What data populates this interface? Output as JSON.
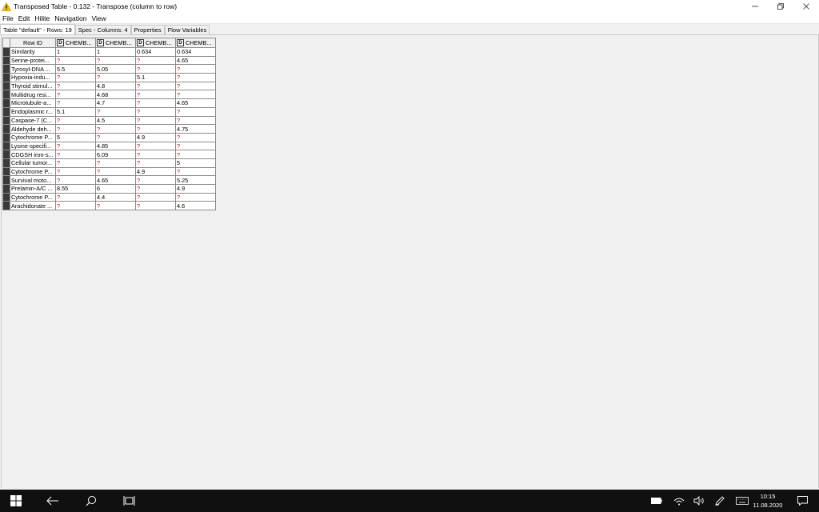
{
  "window": {
    "title": "Transposed Table - 0:132 - Transpose (column to row)",
    "icon": "warning-triangle-icon"
  },
  "menu": [
    "File",
    "Edit",
    "Hilite",
    "Navigation",
    "View"
  ],
  "tabs": [
    {
      "label": "Table \"default\" - Rows: 19",
      "active": true
    },
    {
      "label": "Spec - Columns: 4",
      "active": false
    },
    {
      "label": "Properties",
      "active": false
    },
    {
      "label": "Flow Variables",
      "active": false
    }
  ],
  "table": {
    "row_id_header": "Row ID",
    "type_badge": "D",
    "columns": [
      "CHEMB...",
      "CHEMB...",
      "CHEMB...",
      "CHEMB..."
    ],
    "rows": [
      {
        "id": "Similarity",
        "cells": [
          "1",
          "1",
          "0.634",
          "0.634"
        ]
      },
      {
        "id": "Serine-protei...",
        "cells": [
          "?",
          "?",
          "?",
          "4.65"
        ]
      },
      {
        "id": "Tyrosyl-DNA ...",
        "cells": [
          "5.5",
          "5.05",
          "?",
          "?"
        ]
      },
      {
        "id": "Hypoxia-indu...",
        "cells": [
          "?",
          "?",
          "5.1",
          "?"
        ]
      },
      {
        "id": "Thyroid stimul...",
        "cells": [
          "?",
          "4.8",
          "?",
          "?"
        ]
      },
      {
        "id": "Multidrug resi...",
        "cells": [
          "?",
          "4.68",
          "?",
          "?"
        ]
      },
      {
        "id": "Microtubule-a...",
        "cells": [
          "?",
          "4.7",
          "?",
          "4.65"
        ]
      },
      {
        "id": "Endoplasmic r...",
        "cells": [
          "5.1",
          "?",
          "?",
          "?"
        ]
      },
      {
        "id": "Caspase-7 (C...",
        "cells": [
          "?",
          "4.5",
          "?",
          "?"
        ]
      },
      {
        "id": "Aldehyde deh...",
        "cells": [
          "?",
          "?",
          "?",
          "4.75"
        ]
      },
      {
        "id": "Cytochrome P...",
        "cells": [
          "5",
          "?",
          "4.9",
          "?"
        ]
      },
      {
        "id": "Lysine-specifi...",
        "cells": [
          "?",
          "4.85",
          "?",
          "?"
        ]
      },
      {
        "id": "CDGSH iron-s...",
        "cells": [
          "?",
          "6.09",
          "?",
          "?"
        ]
      },
      {
        "id": "Cellular tumor...",
        "cells": [
          "?",
          "?",
          "?",
          "5"
        ]
      },
      {
        "id": "Cytochrome P...",
        "cells": [
          "?",
          "?",
          "4.9",
          "?"
        ]
      },
      {
        "id": "Survival moto...",
        "cells": [
          "?",
          "4.65",
          "?",
          "5.25"
        ]
      },
      {
        "id": "Prelamin-A/C ...",
        "cells": [
          "8.55",
          "6",
          "?",
          "4.9"
        ]
      },
      {
        "id": "Cytochrome P...",
        "cells": [
          "?",
          "4.4",
          "?",
          "?"
        ]
      },
      {
        "id": "Arachidonate ...",
        "cells": [
          "?",
          "?",
          "?",
          "4.6"
        ]
      }
    ],
    "missing_color": "#d00000"
  },
  "taskbar": {
    "time": "10:15",
    "date": "11.08.2020"
  }
}
